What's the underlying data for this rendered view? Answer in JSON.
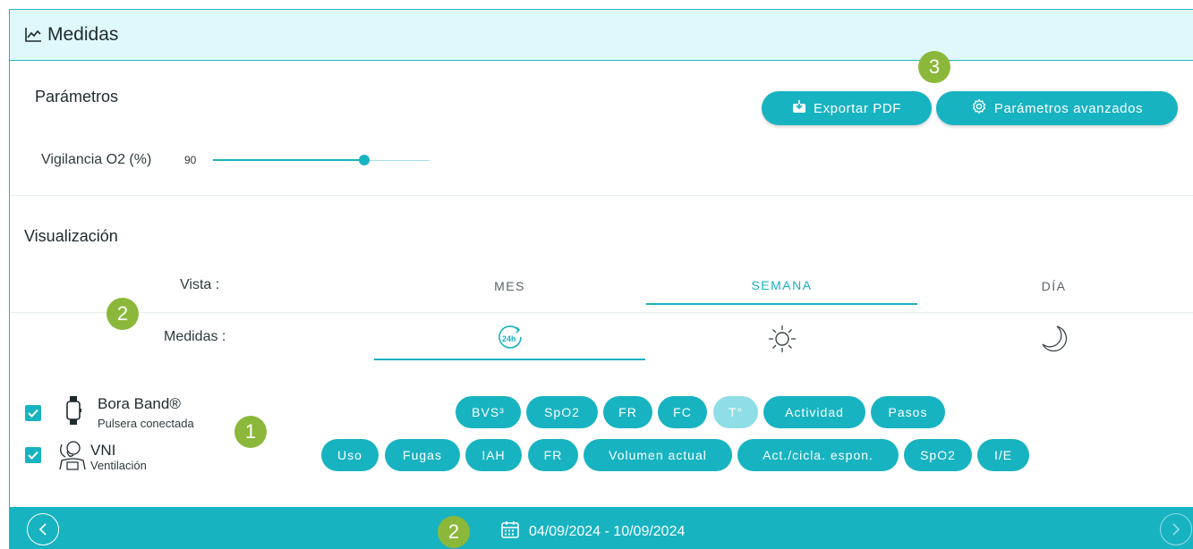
{
  "header": {
    "title": "Medidas",
    "icon": "line-chart-icon"
  },
  "parametros": {
    "title": "Parámetros",
    "export_label": "Exportar PDF",
    "advanced_label": "Parámetros avanzados",
    "slider_label": "Vigilancia O2 (%)",
    "slider_value": "90",
    "slider_fraction": 0.7
  },
  "visualizacion": {
    "title": "Visualización",
    "vista_label": "Vista :",
    "medidas_label": "Medidas :",
    "tabs": [
      {
        "label": "MES",
        "active": false
      },
      {
        "label": "SEMANA",
        "active": true
      },
      {
        "label": "DÍA",
        "active": false
      }
    ],
    "measure_tabs": [
      {
        "icon": "24h-icon",
        "active": true
      },
      {
        "icon": "sun-icon",
        "active": false
      },
      {
        "icon": "moon-icon",
        "active": false
      }
    ]
  },
  "devices": [
    {
      "name": "Bora Band®",
      "subtitle": "Pulsera conectada",
      "icon": "watch-icon",
      "checked": true
    },
    {
      "name": "VNI",
      "subtitle": "Ventilación",
      "icon": "ventilation-icon",
      "checked": true
    }
  ],
  "chips_row1": [
    {
      "label": "BVS³",
      "disabled": false
    },
    {
      "label": "SpO2",
      "disabled": false
    },
    {
      "label": "FR",
      "disabled": false
    },
    {
      "label": "FC",
      "disabled": false
    },
    {
      "label": "T°",
      "disabled": true
    },
    {
      "label": "Actividad",
      "disabled": false
    },
    {
      "label": "Pasos",
      "disabled": false
    }
  ],
  "chips_row2": [
    {
      "label": "Uso"
    },
    {
      "label": "Fugas"
    },
    {
      "label": "IAH"
    },
    {
      "label": "FR"
    },
    {
      "label": "Volumen actual"
    },
    {
      "label": "Act./cicla. espon."
    },
    {
      "label": "SpO2"
    },
    {
      "label": "I/E"
    }
  ],
  "badges": {
    "one": "1",
    "two": "2",
    "three": "3"
  },
  "footer": {
    "date_range": "04/09/2024 - 10/09/2024"
  },
  "colors": {
    "accent": "#18b3c1",
    "header_bg": "#dff8fb",
    "badge": "#8bb83a"
  }
}
